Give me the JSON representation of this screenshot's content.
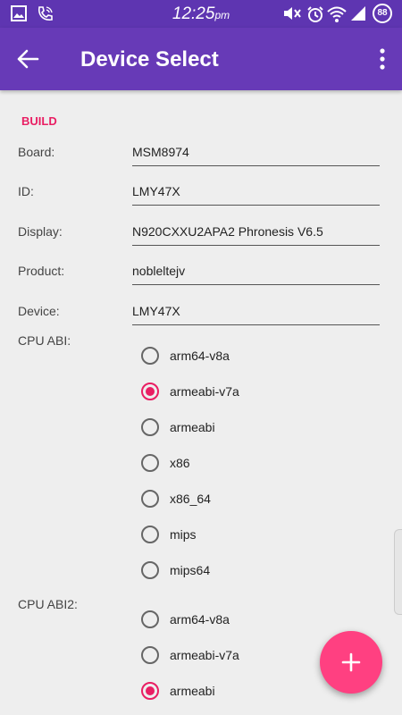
{
  "status_bar": {
    "time": "12:25",
    "ampm": "pm",
    "battery": "88",
    "icons": [
      "gallery-icon",
      "call-icon",
      "mute-icon",
      "alarm-icon",
      "wifi-icon",
      "signal-icon",
      "battery-icon"
    ]
  },
  "app_bar": {
    "title": "Device Select",
    "back_icon": "arrow-back-icon",
    "menu_icon": "more-vert-icon"
  },
  "build": {
    "section_title": "BUILD",
    "fields": [
      {
        "label": "Board:",
        "value": "MSM8974"
      },
      {
        "label": "ID:",
        "value": "LMY47X"
      },
      {
        "label": "Display:",
        "value": "N920CXXU2APA2 Phronesis V6.5"
      },
      {
        "label": "Product:",
        "value": "nobleltejv"
      },
      {
        "label": "Device:",
        "value": "LMY47X"
      }
    ]
  },
  "cpu_abi": {
    "label": "CPU ABI:",
    "options": [
      "arm64-v8a",
      "armeabi-v7a",
      "armeabi",
      "x86",
      "x86_64",
      "mips",
      "mips64"
    ],
    "selected": "armeabi-v7a"
  },
  "cpu_abi2": {
    "label": "CPU ABI2:",
    "options": [
      "arm64-v8a",
      "armeabi-v7a",
      "armeabi"
    ],
    "selected": "armeabi"
  },
  "fab": {
    "icon": "plus-icon"
  },
  "colors": {
    "primary": "#673ab7",
    "primary_dark": "#5e35b1",
    "accent": "#e91e63",
    "fab": "#ff4081"
  }
}
